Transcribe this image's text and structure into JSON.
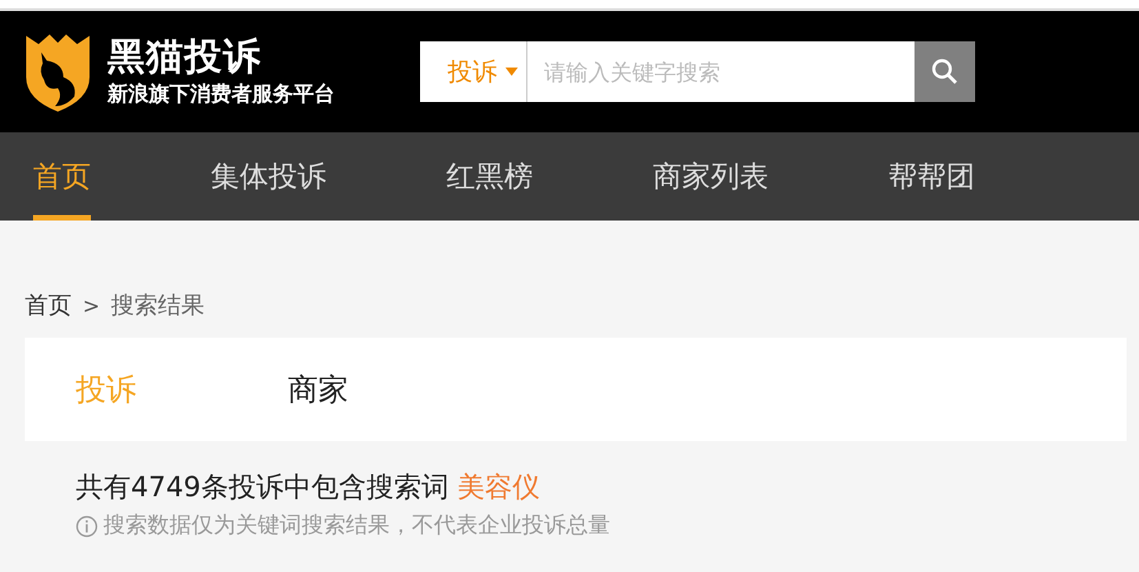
{
  "header": {
    "logo_title": "黑猫投诉",
    "logo_subtitle": "新浪旗下消费者服务平台",
    "search": {
      "scope": "投诉",
      "placeholder": "请输入关键字搜索"
    }
  },
  "nav": [
    {
      "label": "首页",
      "selected": true
    },
    {
      "label": "集体投诉",
      "selected": false
    },
    {
      "label": "红黑榜",
      "selected": false
    },
    {
      "label": "商家列表",
      "selected": false
    },
    {
      "label": "帮帮团",
      "selected": false
    }
  ],
  "breadcrumb": {
    "items": [
      "首页",
      "搜索结果"
    ],
    "separator": ">"
  },
  "result_tabs": [
    {
      "label": "投诉",
      "selected": true
    },
    {
      "label": "商家",
      "selected": false
    }
  ],
  "result": {
    "text": "共有4749条投诉中包含搜索词",
    "keyword": "美容仪"
  },
  "note": "搜索数据仅为关键词搜索结果，不代表企业投诉总量"
}
